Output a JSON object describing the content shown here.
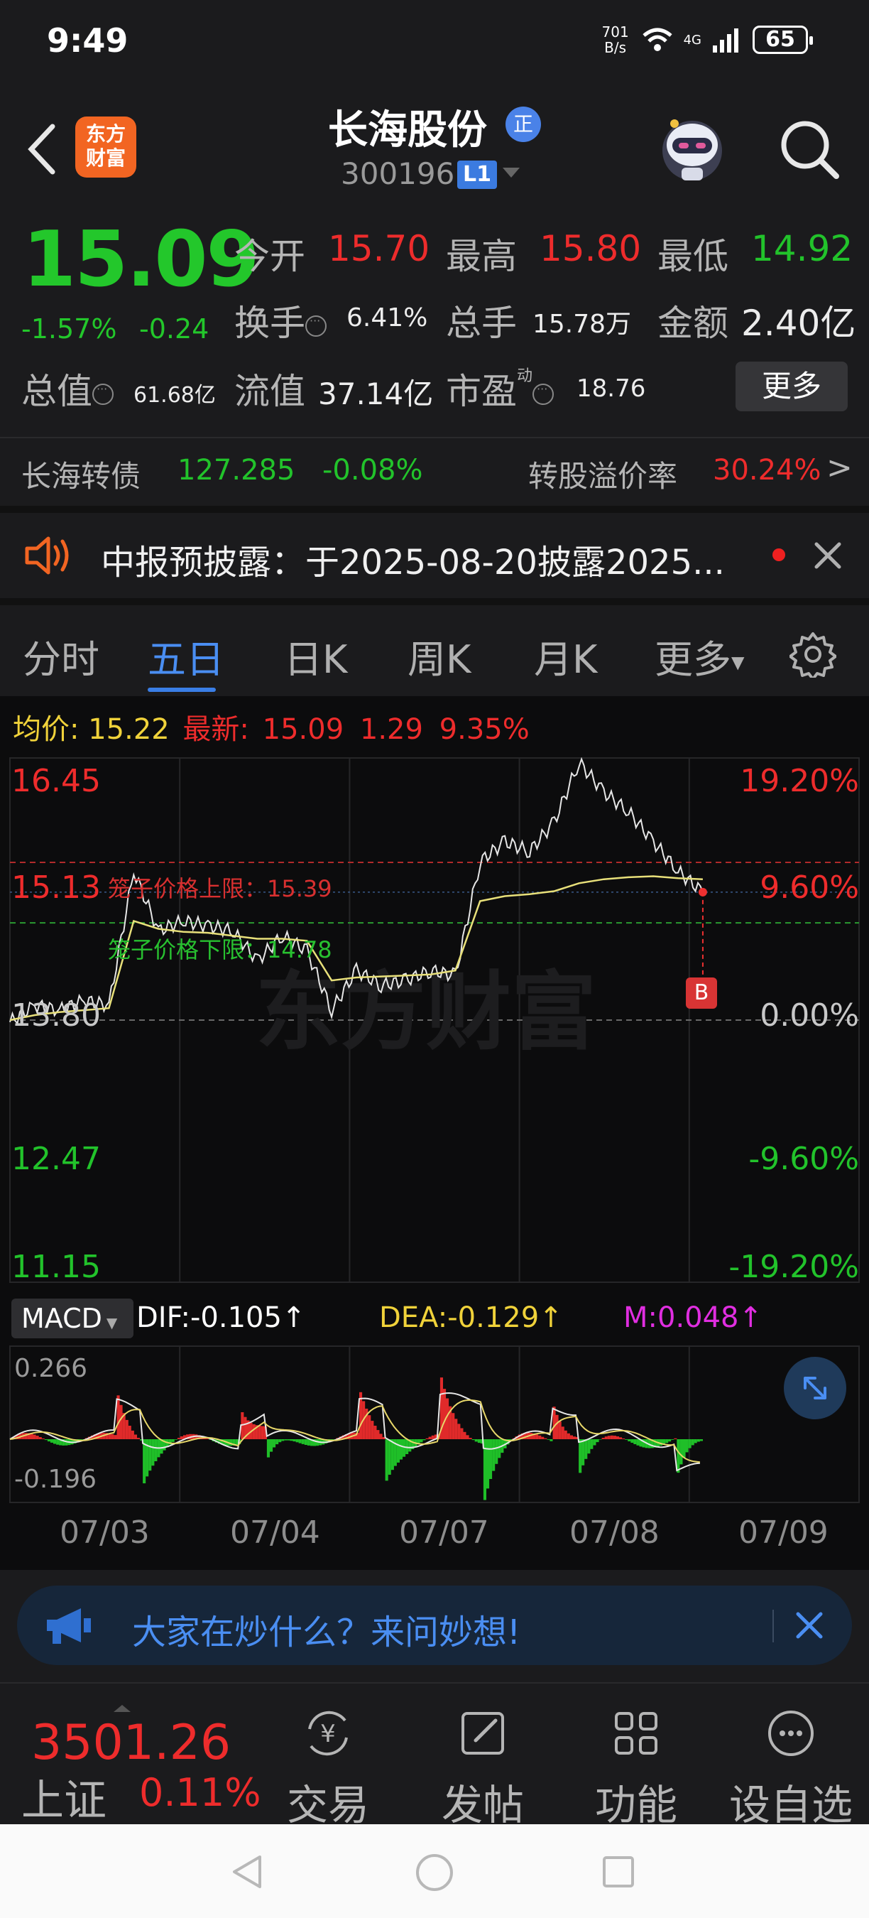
{
  "status_bar": {
    "time": "9:49",
    "net_speed_top": "701",
    "net_speed_bottom": "B/s",
    "signal_label": "4G",
    "wifi_label": "6",
    "battery": "65"
  },
  "header": {
    "app_logo_line1": "东方",
    "app_logo_line2": "财富",
    "stock_name": "长海股份",
    "badge": "正",
    "stock_code": "300196",
    "level_badge": "L1"
  },
  "quote": {
    "price": "15.09",
    "change_pct": "-1.57%",
    "change_amt": "-0.24",
    "open_label": "今开",
    "open": "15.70",
    "high_label": "最高",
    "high": "15.80",
    "low_label": "最低",
    "low": "14.92",
    "turnover_label": "换手",
    "turnover": "6.41%",
    "volume_label": "总手",
    "volume": "15.78万",
    "amount_label": "金额",
    "amount": "2.40亿",
    "mktcap_label": "总值",
    "mktcap": "61.68亿",
    "float_label": "流值",
    "float": "37.14亿",
    "pe_label": "市盈",
    "pe_super": "动",
    "pe": "18.76",
    "more_label": "更多"
  },
  "bond": {
    "name": "长海转债",
    "price": "127.285",
    "change": "-0.08%",
    "premium_label": "转股溢价率",
    "premium": "30.24%",
    "arrow": ">"
  },
  "notice": {
    "text": "中报预披露：于2025-08-20披露2025..."
  },
  "tabs": [
    {
      "label": "分时"
    },
    {
      "label": "五日"
    },
    {
      "label": "日K"
    },
    {
      "label": "周K"
    },
    {
      "label": "月K"
    },
    {
      "label": "更多"
    }
  ],
  "chart_legend": {
    "avg_label": "均价:",
    "avg": "15.22",
    "latest_label": "最新:",
    "latest": "15.09",
    "chg": "1.29",
    "chg_pct": "9.35%"
  },
  "chart_labels": {
    "y_left": [
      "16.45",
      "15.13",
      "13.80",
      "12.47",
      "11.15"
    ],
    "y_right": [
      "19.20%",
      "9.60%",
      "0.00%",
      "-9.60%",
      "-19.20%"
    ],
    "cage_upper": "笼子价格上限：15.39",
    "cage_lower": "笼子价格下限：14.78",
    "buy_marker": "B",
    "watermark": "东方财富"
  },
  "macd": {
    "selector": "MACD",
    "dif": "DIF:-0.105↑",
    "dea": "DEA:-0.129↑",
    "m": "M:0.048↑",
    "y_top": "0.266",
    "y_bottom": "-0.196"
  },
  "dates": [
    "07/03",
    "07/04",
    "07/07",
    "07/08",
    "07/09"
  ],
  "ask_banner": {
    "text": "大家在炒什么？来问妙想!"
  },
  "bottom_nav": {
    "index_value": "3501.26",
    "index_name": "上证",
    "index_pct": "0.11%",
    "items": [
      {
        "label": "交易"
      },
      {
        "label": "发帖"
      },
      {
        "label": "功能"
      },
      {
        "label": "设自选"
      }
    ]
  },
  "colors": {
    "up": "#ee2c2c",
    "down": "#22c32b",
    "accent": "#4a8ef2",
    "avg_line": "#e8e07a"
  },
  "chart_data": {
    "type": "line",
    "title": "",
    "x": [
      "07/03",
      "07/04",
      "07/07",
      "07/08",
      "07/09"
    ],
    "ylim": [
      11.15,
      16.45
    ],
    "prev_close": 13.8,
    "cage_upper": 15.39,
    "cage_lower": 14.78,
    "series": [
      {
        "name": "最新",
        "values": [
          13.78,
          13.95,
          13.9,
          14.0,
          13.95,
          15.3,
          14.7,
          14.8,
          14.75,
          14.7,
          14.4,
          14.65,
          14.5,
          13.9,
          14.3,
          14.15,
          14.2,
          14.3,
          14.25,
          15.4,
          15.6,
          15.5,
          15.8,
          16.4,
          16.1,
          15.9,
          15.6,
          15.3,
          15.09
        ]
      },
      {
        "name": "均价",
        "values": [
          13.8,
          13.85,
          13.88,
          13.9,
          13.92,
          14.8,
          14.72,
          14.69,
          14.68,
          14.65,
          14.62,
          14.62,
          14.6,
          14.2,
          14.23,
          14.24,
          14.25,
          14.26,
          14.3,
          15.0,
          15.05,
          15.07,
          15.1,
          15.18,
          15.22,
          15.24,
          15.25,
          15.23,
          15.22
        ]
      }
    ]
  }
}
